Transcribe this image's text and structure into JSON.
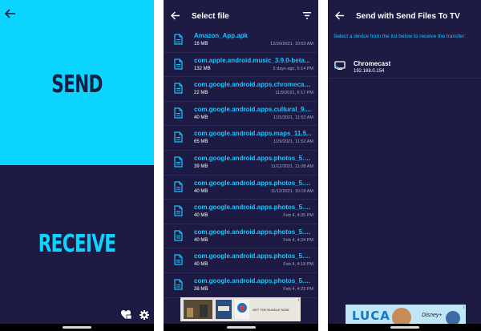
{
  "screen1": {
    "send_label": "SEND",
    "receive_label": "RECEIVE",
    "send_color": "#0ad4ff",
    "background": "#1d1a44"
  },
  "screen2": {
    "title": "Select file",
    "files": [
      {
        "name": "Amazon_App.apk",
        "size": "16 MB",
        "date": "12/20/2021, 10:53 AM"
      },
      {
        "name": "com.apple.android.music_3.9.0-beta...",
        "size": "132 MB",
        "date": "5 days ago, 5:14 PM"
      },
      {
        "name": "com.google.android.apps.chromecas...",
        "size": "22 MB",
        "date": "11/9/2021, 6:17 PM"
      },
      {
        "name": "com.google.android.apps.cultural_9....",
        "size": "40 MB",
        "date": "11/5/2021, 11:52 AM"
      },
      {
        "name": "com.google.android.apps.maps_11.5...",
        "size": "65 MB",
        "date": "11/9/2021, 11:52 AM"
      },
      {
        "name": "com.google.android.apps.photos_5.6...",
        "size": "39 MB",
        "date": "11/12/2021, 11:08 AM"
      },
      {
        "name": "com.google.android.apps.photos_5.6...",
        "size": "40 MB",
        "date": "11/12/2021, 10:18 AM"
      },
      {
        "name": "com.google.android.apps.photos_5.7...",
        "size": "40 MB",
        "date": "Feb 4, 4:35 PM"
      },
      {
        "name": "com.google.android.apps.photos_5.7...",
        "size": "40 MB",
        "date": "Feb 4, 4:24 PM"
      },
      {
        "name": "com.google.android.apps.photos_5.7...",
        "size": "40 MB",
        "date": "Feb 4, 4:18 PM"
      },
      {
        "name": "com.google.android.apps.photos_5.7...",
        "size": "38 MB",
        "date": "Feb 4, 4:23 PM"
      }
    ],
    "ad": {
      "text": "GET THE BUNDLE NOW",
      "info": "i"
    }
  },
  "screen3": {
    "title": "Send with Send Files To TV",
    "description": "Select a device from the list below to receive the transfer:",
    "device": {
      "name": "Chromecast",
      "ip": "192.168.0.154",
      "icon": "tv-icon"
    },
    "ad": {
      "title": "LUCA",
      "brand": "Disney+",
      "info": "i"
    }
  },
  "colors": {
    "accent": "#17c7ff",
    "screen_bg": "#1d1a44",
    "text": "#ffffff",
    "muted": "#a8a6c6"
  }
}
